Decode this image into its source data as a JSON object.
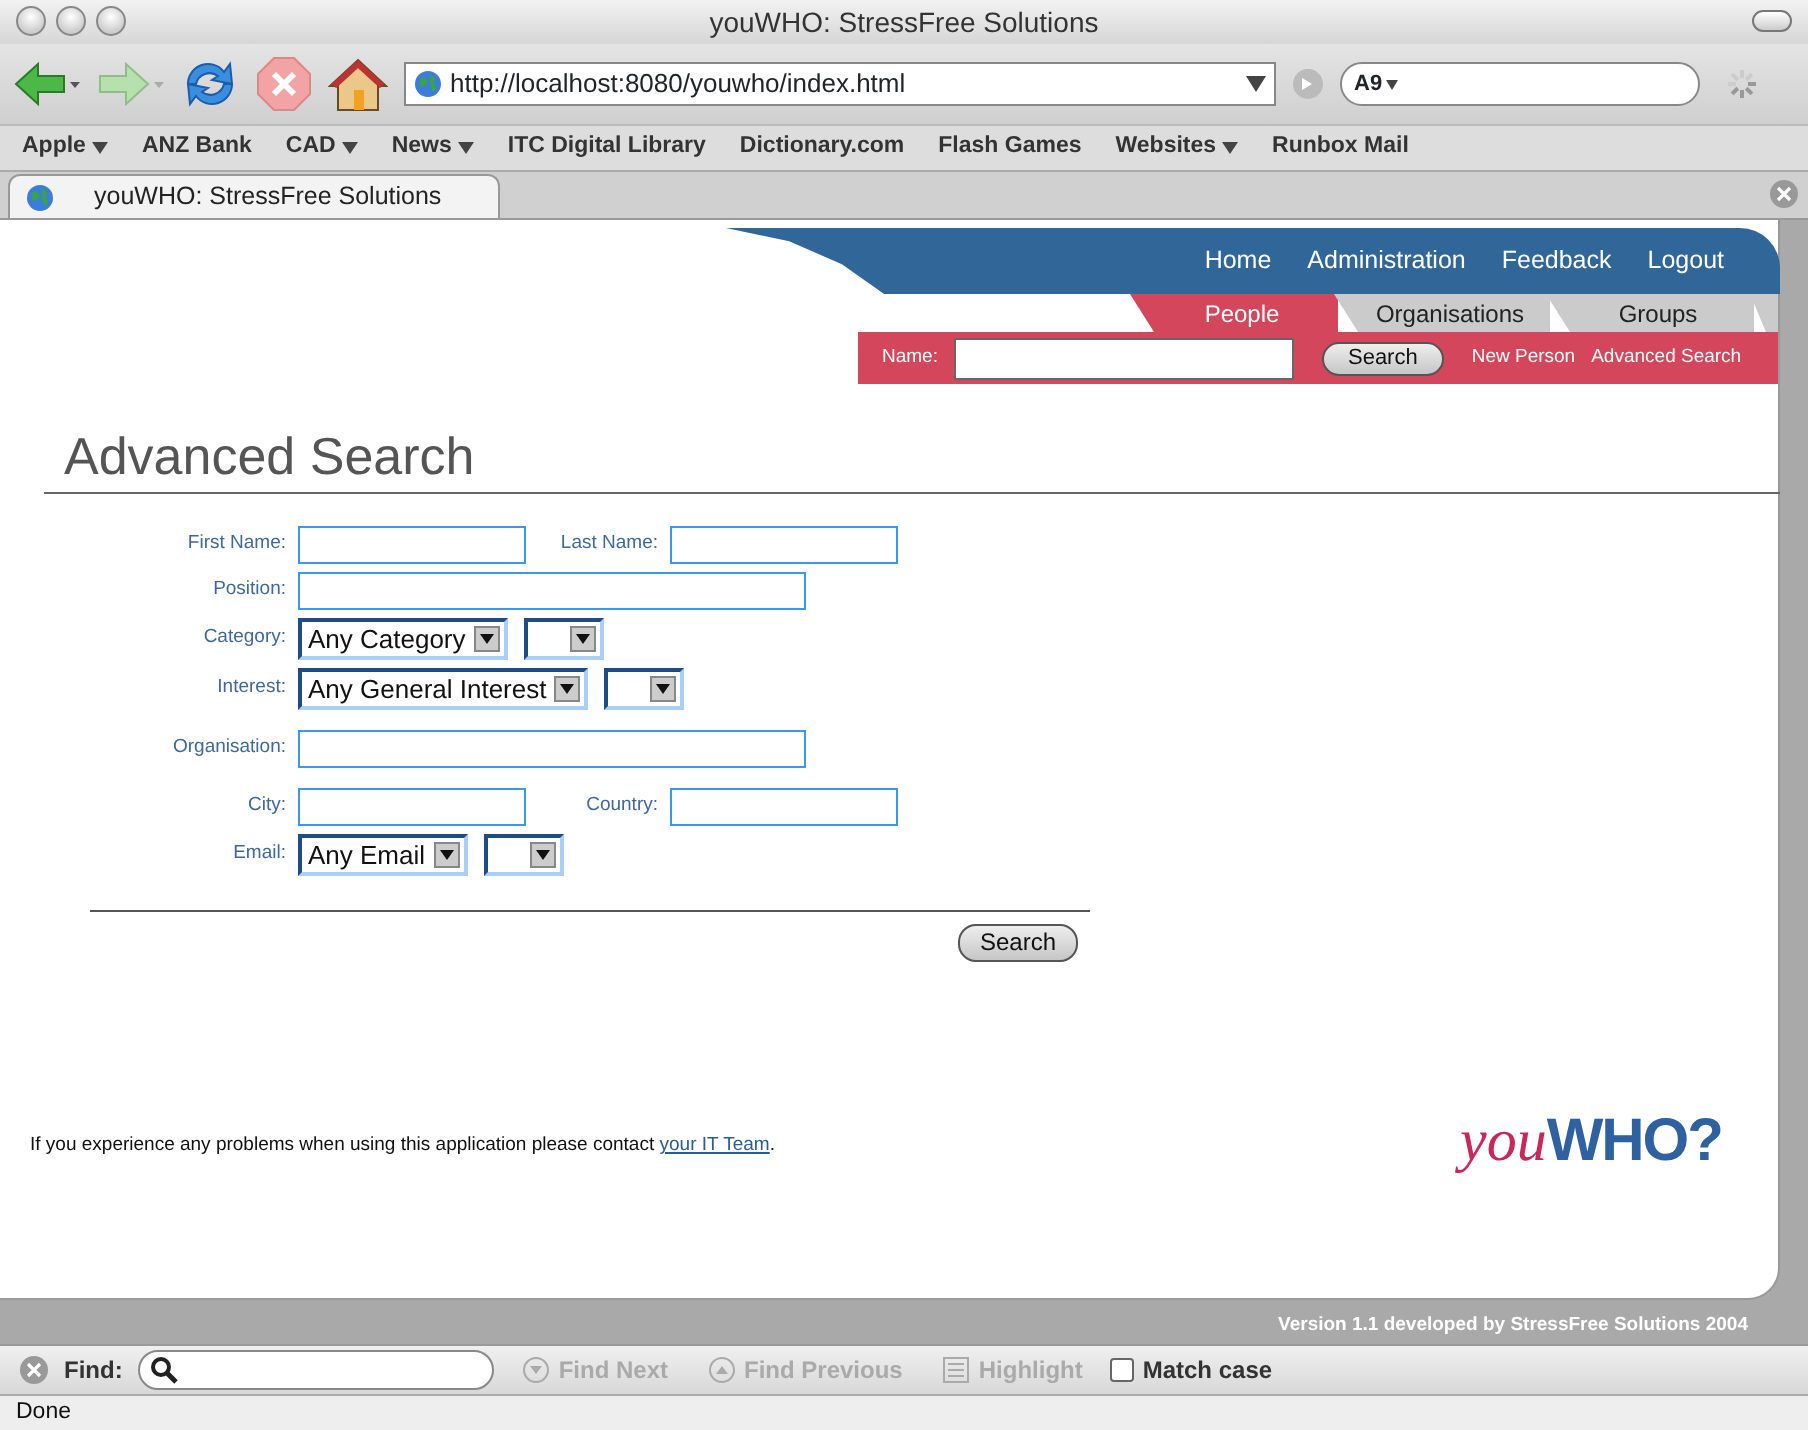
{
  "window": {
    "title": "youWHO: StressFree Solutions"
  },
  "toolbar": {
    "url": "http://localhost:8080/youwho/index.html",
    "search_engine": "A9"
  },
  "bookmarks": [
    {
      "label": "Apple",
      "menu": true
    },
    {
      "label": "ANZ Bank",
      "menu": false
    },
    {
      "label": "CAD",
      "menu": true
    },
    {
      "label": "News",
      "menu": true
    },
    {
      "label": "ITC Digital Library",
      "menu": false
    },
    {
      "label": "Dictionary.com",
      "menu": false
    },
    {
      "label": "Flash Games",
      "menu": false
    },
    {
      "label": "Websites",
      "menu": true
    },
    {
      "label": "Runbox Mail",
      "menu": false
    }
  ],
  "browser_tabs": [
    {
      "label": "youWHO: StressFree Solutions",
      "selected": true
    }
  ],
  "header": {
    "nav": [
      "Home",
      "Administration",
      "Feedback",
      "Logout"
    ],
    "tabs": [
      {
        "label": "People",
        "selected": true
      },
      {
        "label": "Organisations",
        "selected": false
      },
      {
        "label": "Groups",
        "selected": false
      }
    ],
    "quick_search": {
      "label": "Name:",
      "button": "Search",
      "links": [
        "New Person",
        "Advanced Search"
      ]
    }
  },
  "heading": "Advanced Search",
  "form": {
    "rows": [
      {
        "fields": [
          {
            "label": "First Name:",
            "kind": "text"
          },
          {
            "label": "Last Name:",
            "kind": "text"
          }
        ]
      },
      {
        "fields": [
          {
            "label": "Position:",
            "kind": "wide"
          }
        ]
      },
      {
        "fields": [
          {
            "label": "Category:",
            "kind": "select",
            "value": "Any Category"
          }
        ]
      },
      {
        "fields": [
          {
            "label": "Interest:",
            "kind": "select",
            "value": "Any General Interest"
          }
        ]
      },
      {
        "fields": [
          {
            "label": "Organisation:",
            "kind": "wide"
          }
        ]
      },
      {
        "fields": [
          {
            "label": "City:",
            "kind": "text"
          },
          {
            "label": "Country:",
            "kind": "text"
          }
        ]
      },
      {
        "fields": [
          {
            "label": "Email:",
            "kind": "select",
            "value": "Any Email"
          }
        ]
      }
    ],
    "button": "Search"
  },
  "footer": {
    "text": "If you experience any problems when using this application please contact ",
    "link": "your IT Team",
    "after": ".",
    "logo_first": "you",
    "logo_second": "WHO?",
    "version": "Version 1.1 developed by StressFree Solutions 2004"
  },
  "find_bar": {
    "label": "Find:",
    "buttons": [
      {
        "label": "Find Next",
        "kind": "down",
        "disabled": true
      },
      {
        "label": "Find Previous",
        "kind": "up",
        "disabled": true
      },
      {
        "label": "Highlight",
        "kind": "highlight",
        "disabled": true
      }
    ],
    "match_case": {
      "label": "Match case",
      "checked": false
    }
  },
  "status_bar": "Done"
}
